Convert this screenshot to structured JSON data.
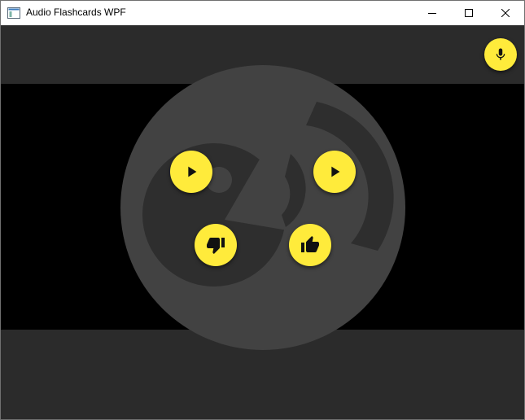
{
  "window": {
    "title": "Audio Flashcards WPF",
    "controls": [
      "minimize",
      "maximize",
      "close"
    ]
  },
  "colors": {
    "accent": "#FFEB3B",
    "background": "#2B2B2B",
    "band": "#000000",
    "disc": "#424242",
    "disc_inner": "#2E2E2E"
  },
  "icons": {
    "app": "app-icon",
    "microphone": "microphone-icon",
    "play": "play-icon",
    "thumb_down": "thumb-down-icon",
    "thumb_up": "thumb-up-icon"
  }
}
